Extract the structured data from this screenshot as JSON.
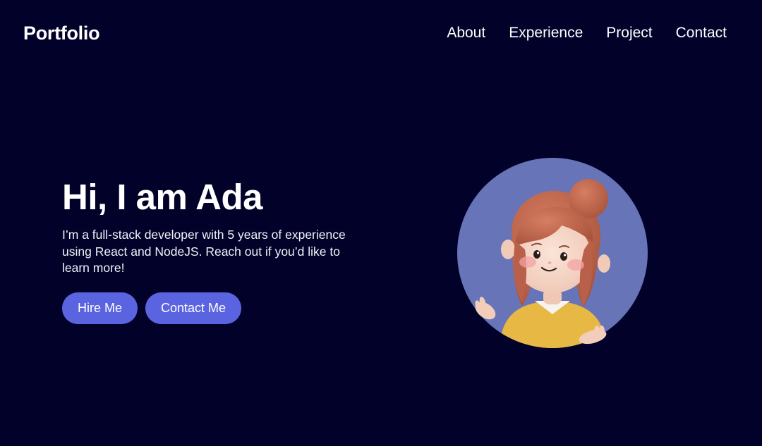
{
  "colors": {
    "background": "#02012a",
    "accent": "#5b64e0",
    "avatar_circle": "#6874b8"
  },
  "header": {
    "logo": "Portfolio",
    "nav": [
      {
        "label": "About"
      },
      {
        "label": "Experience"
      },
      {
        "label": "Project"
      },
      {
        "label": "Contact"
      }
    ]
  },
  "hero": {
    "title": "Hi, I am Ada",
    "description": "I’m a full-stack developer with 5 years of experience using React and NodeJS. Reach out if you’d like to learn more!",
    "buttons": {
      "hire": "Hire Me",
      "contact": "Contact Me"
    },
    "avatar_icon": "cartoon-girl-avatar"
  }
}
